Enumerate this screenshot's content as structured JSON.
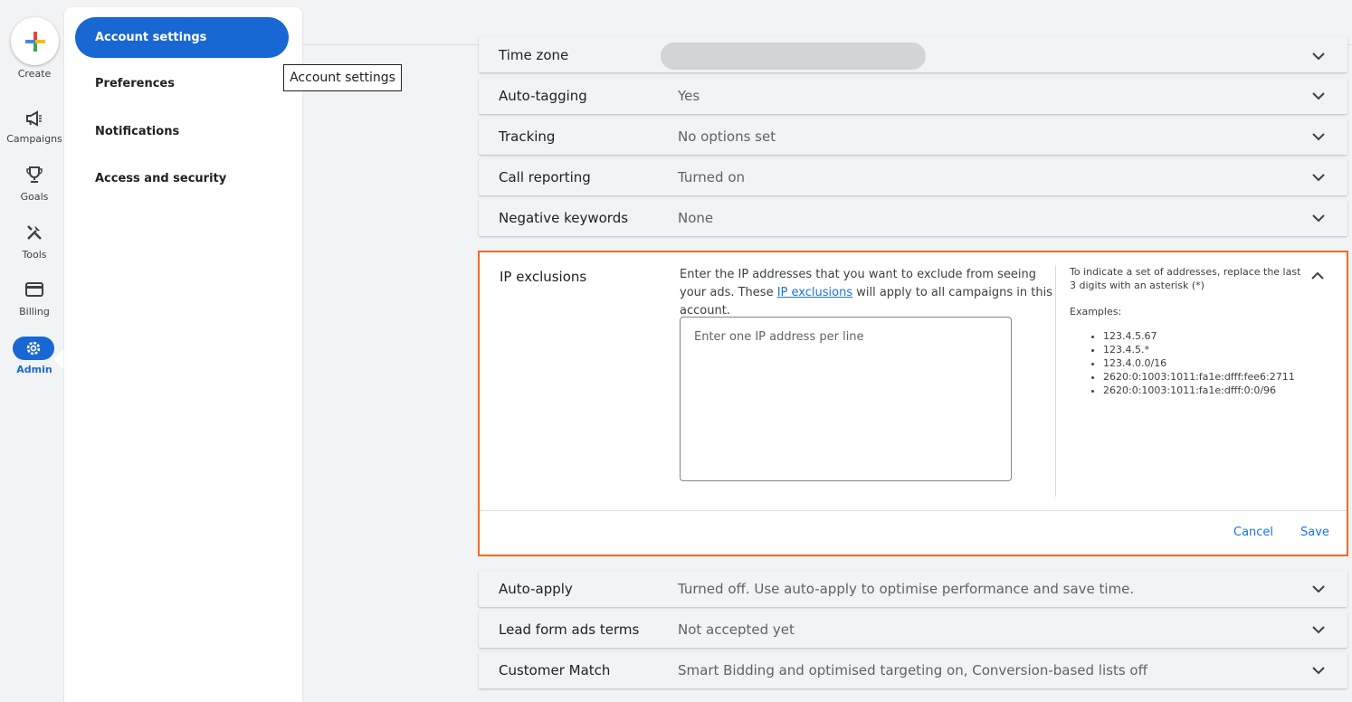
{
  "rail": {
    "create_label": "Create",
    "items": [
      {
        "label": "Campaigns",
        "icon": "megaphone-icon"
      },
      {
        "label": "Goals",
        "icon": "trophy-icon"
      },
      {
        "label": "Tools",
        "icon": "tools-icon"
      },
      {
        "label": "Billing",
        "icon": "credit-card-icon"
      },
      {
        "label": "Admin",
        "icon": "gear-icon",
        "active": true
      }
    ]
  },
  "submenu": {
    "items": [
      {
        "label": "Account settings",
        "active": true
      },
      {
        "label": "Preferences"
      },
      {
        "label": "Notifications"
      },
      {
        "label": "Access and security"
      }
    ]
  },
  "tooltip": {
    "text": "Account settings"
  },
  "settings": {
    "rows_top": [
      {
        "title": "Time zone",
        "value": ""
      },
      {
        "title": "Auto-tagging",
        "value": "Yes"
      },
      {
        "title": "Tracking",
        "value": "No options set"
      },
      {
        "title": "Call reporting",
        "value": "Turned on"
      },
      {
        "title": "Negative keywords",
        "value": "None"
      }
    ],
    "ip_exclusions": {
      "title": "IP exclusions",
      "desc_before": "Enter the IP addresses that you want to exclude from seeing your ads. These ",
      "desc_link": "IP exclusions",
      "desc_after": " will apply to all campaigns in this account.",
      "textarea_placeholder": "Enter one IP address per line",
      "help_text": "To indicate a set of addresses, replace the last 3 digits with an asterisk (*)",
      "examples_label": "Examples:",
      "examples": [
        "123.4.5.67",
        "123.4.5.*",
        "123.4.0.0/16",
        "2620:0:1003:1011:fa1e:dfff:fee6:2711",
        "2620:0:1003:1011:fa1e:dfff:0:0/96"
      ],
      "cancel_label": "Cancel",
      "save_label": "Save"
    },
    "rows_bottom": [
      {
        "title": "Auto-apply",
        "value": "Turned off. Use auto-apply to optimise performance and save time."
      },
      {
        "title": "Lead form ads terms",
        "value": "Not accepted yet"
      },
      {
        "title": "Customer Match",
        "value": "Smart Bidding and optimised targeting on, Conversion-based lists off"
      }
    ]
  },
  "colors": {
    "accent": "#1967d2",
    "highlight_border": "#f26b21",
    "link": "#1a73e8"
  }
}
